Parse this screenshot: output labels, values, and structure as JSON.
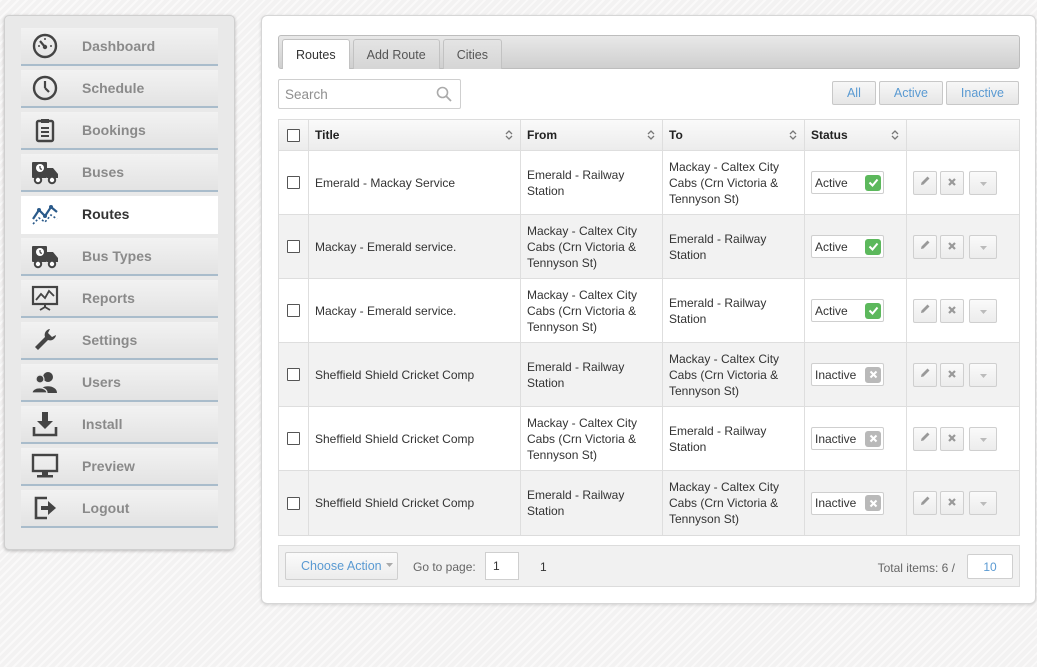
{
  "sidebar": {
    "items": [
      {
        "label": "Dashboard",
        "icon": "speedometer-icon",
        "active": false
      },
      {
        "label": "Schedule",
        "icon": "clock-icon",
        "active": false
      },
      {
        "label": "Bookings",
        "icon": "clipboard-icon",
        "active": false
      },
      {
        "label": "Buses",
        "icon": "bus-truck-icon",
        "active": false
      },
      {
        "label": "Routes",
        "icon": "line-chart-icon",
        "active": true
      },
      {
        "label": "Bus Types",
        "icon": "bus-truck-icon",
        "active": false
      },
      {
        "label": "Reports",
        "icon": "presentation-chart-icon",
        "active": false
      },
      {
        "label": "Settings",
        "icon": "wrench-icon",
        "active": false
      },
      {
        "label": "Users",
        "icon": "users-icon",
        "active": false
      },
      {
        "label": "Install",
        "icon": "download-icon",
        "active": false
      },
      {
        "label": "Preview",
        "icon": "monitor-icon",
        "active": false
      },
      {
        "label": "Logout",
        "icon": "logout-icon",
        "active": false
      }
    ]
  },
  "tabs": [
    {
      "label": "Routes",
      "active": true
    },
    {
      "label": "Add Route",
      "active": false
    },
    {
      "label": "Cities",
      "active": false
    }
  ],
  "search": {
    "placeholder": "Search",
    "value": ""
  },
  "filters": [
    "All",
    "Active",
    "Inactive"
  ],
  "table": {
    "headers": {
      "title": "Title",
      "from": "From",
      "to": "To",
      "status": "Status"
    },
    "rows": [
      {
        "title": "Emerald - Mackay Service",
        "from": "Emerald - Railway Station",
        "to": "Mackay - Caltex City Cabs (Crn Victoria & Tennyson St)",
        "status": "Active",
        "active": true
      },
      {
        "title": "Mackay - Emerald service.",
        "from": "Mackay - Caltex City Cabs (Crn Victoria & Tennyson St)",
        "to": "Emerald - Railway Station",
        "status": "Active",
        "active": true
      },
      {
        "title": "Mackay - Emerald service.",
        "from": "Mackay - Caltex City Cabs (Crn Victoria & Tennyson St)",
        "to": "Emerald - Railway Station",
        "status": "Active",
        "active": true
      },
      {
        "title": "Sheffield Shield Cricket Comp",
        "from": "Emerald - Railway Station",
        "to": "Mackay - Caltex City Cabs (Crn Victoria & Tennyson St)",
        "status": "Inactive",
        "active": false
      },
      {
        "title": "Sheffield Shield Cricket Comp",
        "from": "Mackay - Caltex City Cabs (Crn Victoria & Tennyson St)",
        "to": "Emerald - Railway Station",
        "status": "Inactive",
        "active": false
      },
      {
        "title": "Sheffield Shield Cricket Comp",
        "from": "Emerald - Railway Station",
        "to": "Mackay - Caltex City Cabs (Crn Victoria & Tennyson St)",
        "status": "Inactive",
        "active": false
      }
    ]
  },
  "footer": {
    "choose_action": "Choose Action",
    "goto_label": "Go to page:",
    "page_value": "1",
    "page_link": "1",
    "total_label": "Total items: 6 /",
    "per_page": "10"
  },
  "colors": {
    "accent": "#5a9ad2",
    "active_badge": "#5cb85c",
    "inactive_badge": "#b9b9b9",
    "nav_icon": "#444444",
    "routes_icon": "#2a5a8a"
  }
}
